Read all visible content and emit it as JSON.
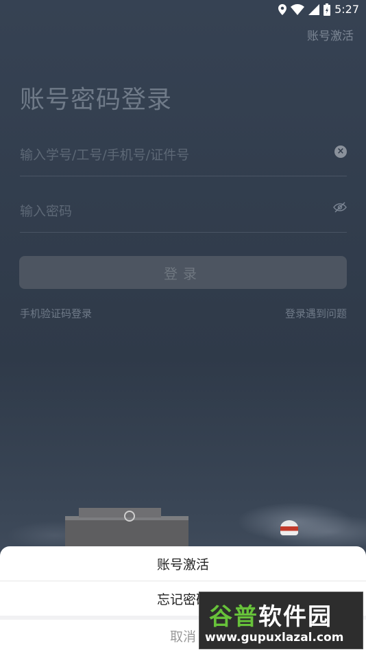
{
  "status_bar": {
    "time": "5:27"
  },
  "header": {
    "activate_link": "账号激活",
    "title": "账号密码登录"
  },
  "form": {
    "account_placeholder": "输入学号/工号/手机号/证件号",
    "account_value": "",
    "password_placeholder": "输入密码",
    "password_value": "",
    "login_label": "登录",
    "sms_login_link": "手机验证码登录",
    "problem_link": "登录遇到问题"
  },
  "action_sheet": {
    "items": [
      {
        "label": "账号激活"
      },
      {
        "label": "忘记密码"
      }
    ],
    "cancel_label": "取消"
  },
  "watermark": {
    "name_part1": "谷普",
    "name_part2": "软件园",
    "url": "www.gupuxlazal.com"
  },
  "icons": [
    "location-icon",
    "wifi-icon",
    "signal-icon",
    "battery-icon",
    "clear-icon",
    "eye-hidden-icon"
  ]
}
